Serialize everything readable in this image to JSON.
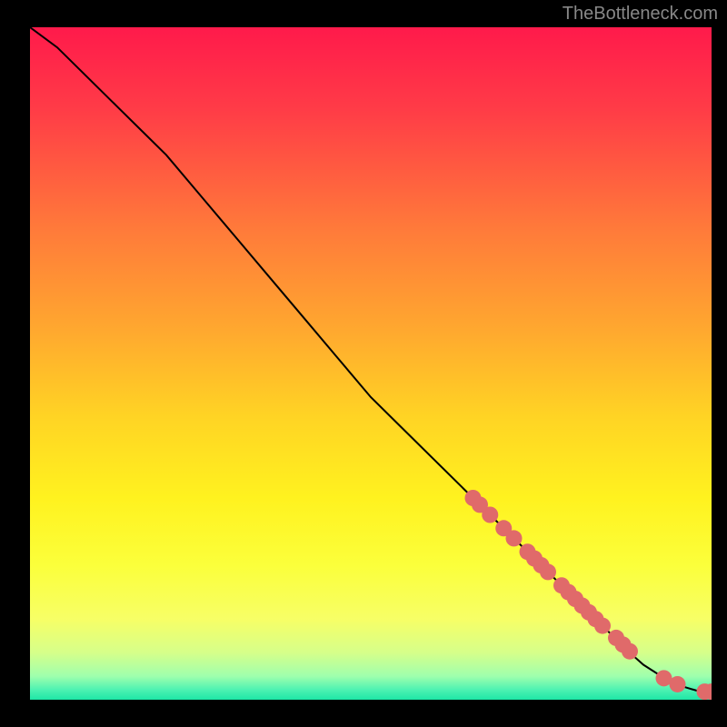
{
  "attribution": "TheBottleneck.com",
  "chart_data": {
    "type": "line",
    "title": "",
    "xlabel": "",
    "ylabel": "",
    "xlim": [
      0,
      100
    ],
    "ylim": [
      0,
      100
    ],
    "curve": {
      "name": "bottleneck-curve",
      "x": [
        0,
        4,
        8,
        12,
        16,
        20,
        25,
        30,
        35,
        40,
        45,
        50,
        55,
        60,
        65,
        70,
        75,
        80,
        85,
        88,
        90,
        92,
        94,
        96,
        98,
        99,
        100
      ],
      "y": [
        100,
        97,
        93,
        89,
        85,
        81,
        75,
        69,
        63,
        57,
        51,
        45,
        40,
        35,
        30,
        25,
        20,
        15,
        10,
        7.0,
        5.2,
        3.9,
        2.8,
        1.9,
        1.3,
        1.2,
        1.2
      ]
    },
    "markers": {
      "name": "highlighted-points",
      "x": [
        65,
        66,
        67.5,
        69.5,
        71,
        73,
        74,
        75,
        76,
        78,
        79,
        80,
        81,
        82,
        83,
        84,
        86,
        87,
        88,
        93,
        95,
        99,
        100
      ],
      "y": [
        30,
        29,
        27.5,
        25.5,
        24,
        22,
        21,
        20,
        19,
        17,
        16,
        15,
        14,
        13,
        12,
        11,
        9.2,
        8.2,
        7.2,
        3.2,
        2.3,
        1.2,
        1.2
      ]
    },
    "gradient_stops": [
      {
        "offset": 0.0,
        "color": "#ff1a4b"
      },
      {
        "offset": 0.12,
        "color": "#ff3b47"
      },
      {
        "offset": 0.3,
        "color": "#ff7a3a"
      },
      {
        "offset": 0.45,
        "color": "#ffa82f"
      },
      {
        "offset": 0.58,
        "color": "#ffd424"
      },
      {
        "offset": 0.7,
        "color": "#fff21f"
      },
      {
        "offset": 0.8,
        "color": "#fbff3b"
      },
      {
        "offset": 0.88,
        "color": "#f7ff66"
      },
      {
        "offset": 0.93,
        "color": "#d6ff8a"
      },
      {
        "offset": 0.965,
        "color": "#9fffad"
      },
      {
        "offset": 0.985,
        "color": "#4ef2b2"
      },
      {
        "offset": 1.0,
        "color": "#1ee6a6"
      }
    ],
    "marker_color": "#e06a6a",
    "line_color": "#000000"
  }
}
